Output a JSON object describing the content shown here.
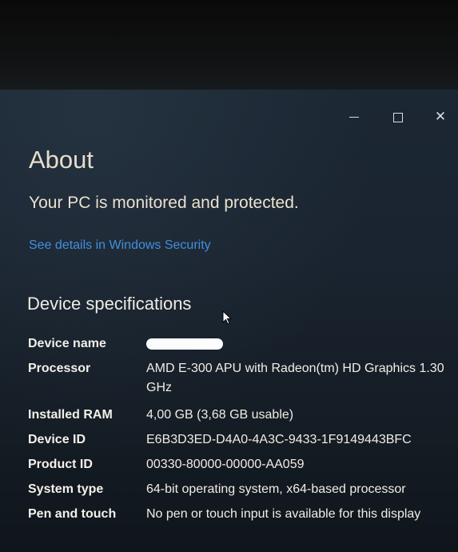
{
  "window": {
    "controls": {
      "minimize_label": "—",
      "maximize_label": "",
      "close_label": "✕"
    }
  },
  "about": {
    "title": "About",
    "protection_status": "Your PC is monitored and protected.",
    "security_link": "See details in Windows Security"
  },
  "device_specs": {
    "heading": "Device specifications",
    "rows": [
      {
        "label": "Device name",
        "value": ""
      },
      {
        "label": "Processor",
        "value": "AMD E-300 APU with Radeon(tm) HD Graphics 1.30 GHz"
      },
      {
        "label": "Installed RAM",
        "value": "4,00 GB (3,68 GB usable)"
      },
      {
        "label": "Device ID",
        "value": "E6B3D3ED-D4A0-4A3C-9433-1F9149443BFC"
      },
      {
        "label": "Product ID",
        "value": "00330-80000-00000-AA059"
      },
      {
        "label": "System type",
        "value": "64-bit operating system, x64-based processor"
      },
      {
        "label": "Pen and touch",
        "value": "No pen or touch input is available for this display"
      }
    ]
  },
  "colors": {
    "link": "#3e8fe0",
    "title_text": "#f0e4cf",
    "window_background": "#1b2733"
  }
}
